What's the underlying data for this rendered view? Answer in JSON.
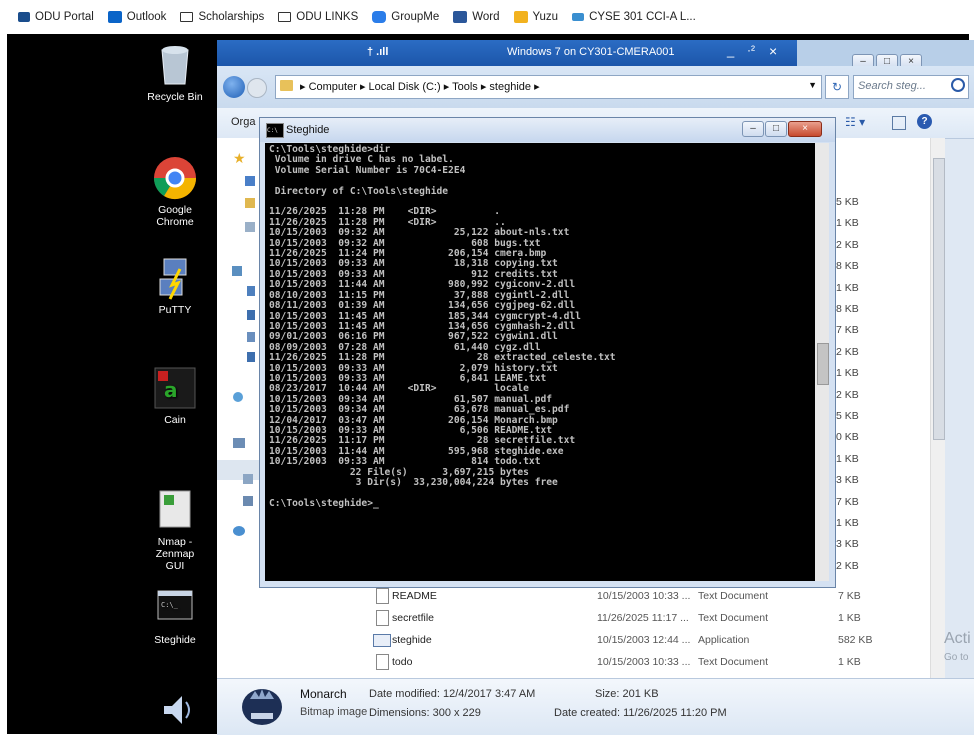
{
  "bookmarks": [
    {
      "label": "ODU Portal",
      "icon": "odu-crown-icon",
      "color": "#1a4d8c"
    },
    {
      "label": "Outlook",
      "icon": "outlook-icon",
      "color": "#0a64c8"
    },
    {
      "label": "Scholarships",
      "icon": "folder-icon",
      "color": "#333333"
    },
    {
      "label": "ODU LINKS",
      "icon": "folder-icon",
      "color": "#333333"
    },
    {
      "label": "GroupMe",
      "icon": "groupme-icon",
      "color": "#2b7de9"
    },
    {
      "label": "Word",
      "icon": "word-icon",
      "color": "#2b579a"
    },
    {
      "label": "Yuzu",
      "icon": "yuzu-icon",
      "color": "#f2b21f"
    },
    {
      "label": "CYSE 301 CCI-A L...",
      "icon": "cyse-icon",
      "color": "#3a8fd0"
    }
  ],
  "desktop_icons": [
    {
      "label": "Recycle Bin",
      "icon": "recycle-bin-icon"
    },
    {
      "label": "Google Chrome",
      "icon": "chrome-icon"
    },
    {
      "label": "PuTTY",
      "icon": "putty-icon"
    },
    {
      "label": "Cain",
      "icon": "cain-icon"
    },
    {
      "label": "Nmap - Zenmap GUI",
      "icon": "nmap-icon"
    },
    {
      "label": "Steghide",
      "icon": "steghide-icon"
    }
  ],
  "vm_window": {
    "title": "Windows 7 on CY301-CMERA001",
    "pin_glyph": "† .ıll",
    "minimize": "_",
    "restore": "·²",
    "close": "×"
  },
  "explorer": {
    "breadcrumb": [
      "Computer",
      "Local Disk (C:)",
      "Tools",
      "steghide"
    ],
    "search_placeholder": "Search steg...",
    "organize_label": "Orga",
    "size_column_partial": [
      "5 KB",
      "1 KB",
      "2 KB",
      "8 KB",
      "1 KB",
      "8 KB",
      "7 KB",
      "2 KB",
      "1 KB",
      "2 KB",
      "5 KB",
      "0 KB",
      "1 KB",
      "3 KB",
      "7 KB",
      "1 KB",
      "3 KB",
      "2 KB"
    ],
    "files": [
      {
        "name": "README",
        "date": "10/15/2003 10:33 ...",
        "type": "Text Document",
        "size": "7 KB",
        "icon": "text-file-icon"
      },
      {
        "name": "secretfile",
        "date": "11/26/2025 11:17 ...",
        "type": "Text Document",
        "size": "1 KB",
        "icon": "text-file-icon"
      },
      {
        "name": "steghide",
        "date": "10/15/2003 12:44 ...",
        "type": "Application",
        "size": "582 KB",
        "icon": "application-icon"
      },
      {
        "name": "todo",
        "date": "10/15/2003 10:33 ...",
        "type": "Text Document",
        "size": "1 KB",
        "icon": "text-file-icon"
      }
    ],
    "details": {
      "name": "Monarch",
      "type": "Bitmap image",
      "modified": "Date modified: 12/4/2017 3:47 AM",
      "dimensions": "Dimensions: 300 x 229",
      "size": "Size: 201 KB",
      "created": "Date created: 11/26/2025 11:20 PM"
    },
    "activate_watermark": "Acti",
    "goto_watermark": "Go to"
  },
  "cmd": {
    "title": "Steghide",
    "icon_label": "C:\\",
    "lines": [
      "C:\\Tools\\steghide>dir",
      " Volume in drive C has no label.",
      " Volume Serial Number is 70C4-E2E4",
      "",
      " Directory of C:\\Tools\\steghide",
      "",
      "11/26/2025  11:28 PM    <DIR>          .",
      "11/26/2025  11:28 PM    <DIR>          ..",
      "10/15/2003  09:32 AM            25,122 about-nls.txt",
      "10/15/2003  09:32 AM               608 bugs.txt",
      "11/26/2025  11:24 PM           206,154 cmera.bmp",
      "10/15/2003  09:33 AM            18,318 copying.txt",
      "10/15/2003  09:33 AM               912 credits.txt",
      "10/15/2003  11:44 AM           980,992 cygiconv-2.dll",
      "08/10/2003  11:15 PM            37,888 cygintl-2.dll",
      "08/11/2003  01:39 AM           134,656 cygjpeg-62.dll",
      "10/15/2003  11:45 AM           185,344 cygmcrypt-4.dll",
      "10/15/2003  11:45 AM           134,656 cygmhash-2.dll",
      "09/01/2003  06:16 PM           967,522 cygwin1.dll",
      "08/09/2003  07:28 AM            61,440 cygz.dll",
      "11/26/2025  11:28 PM                28 extracted_celeste.txt",
      "10/15/2003  09:33 AM             2,079 history.txt",
      "10/15/2003  09:33 AM             6,841 LEAME.txt",
      "08/23/2017  10:44 AM    <DIR>          locale",
      "10/15/2003  09:34 AM            61,507 manual.pdf",
      "10/15/2003  09:34 AM            63,678 manual_es.pdf",
      "12/04/2017  03:47 AM           206,154 Monarch.bmp",
      "10/15/2003  09:33 AM             6,506 README.txt",
      "11/26/2025  11:17 PM                28 secretfile.txt",
      "10/15/2003  11:44 AM           595,968 steghide.exe",
      "10/15/2003  09:33 AM               814 todo.txt",
      "              22 File(s)      3,697,215 bytes",
      "               3 Dir(s)  33,230,004,224 bytes free",
      "",
      "C:\\Tools\\steghide>_"
    ]
  }
}
